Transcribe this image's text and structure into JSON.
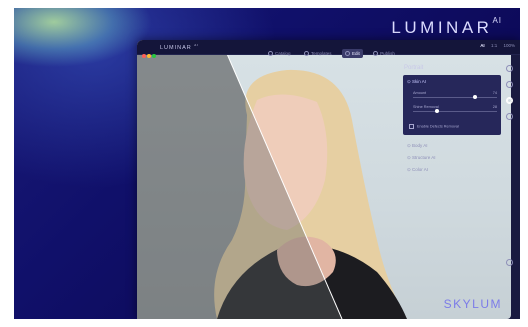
{
  "brand": {
    "name": "LUMINAR",
    "suffix": "AI"
  },
  "footer_brand": "SKYLUM",
  "app": {
    "logo": "LUMINAR",
    "logo_suffix": "AI",
    "tabs": [
      "Catalog",
      "Templates",
      "Edit",
      "Publish"
    ],
    "active_tab": "Edit",
    "right_items": [
      "AI",
      "1:1",
      "100%"
    ]
  },
  "panel": {
    "title": "Portrait",
    "module": {
      "name": "Skin AI",
      "sliders": [
        {
          "label": "Amount",
          "value": "74",
          "fraction": 0.74
        },
        {
          "label": "Shine Removal",
          "value": "28",
          "fraction": 0.28
        }
      ],
      "checkbox_label": "Enable Defects Removal"
    },
    "items": [
      "Body AI",
      "Structure AI",
      "Color AI"
    ]
  },
  "colors": {
    "background": "#10106a",
    "panel": "#191a40",
    "accent": "#7c7ce8"
  }
}
